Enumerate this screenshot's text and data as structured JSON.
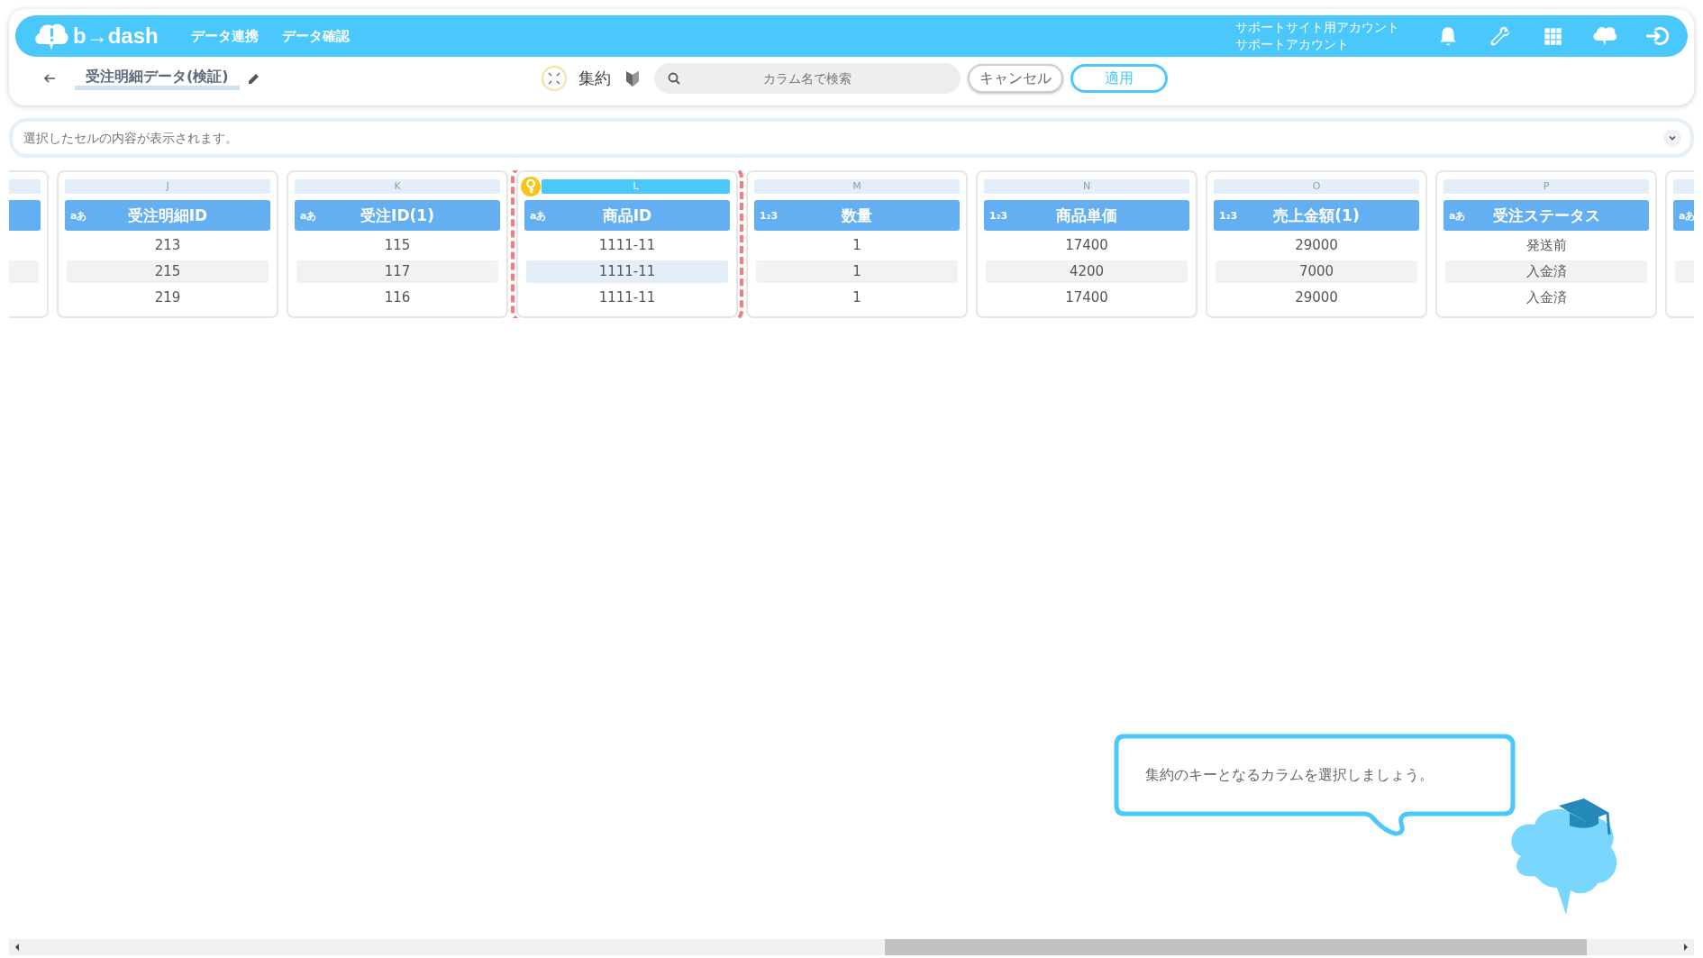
{
  "header": {
    "logo_text": "b→dash",
    "nav": [
      "データ連携",
      "データ確認"
    ],
    "account": [
      "サポートサイト用アカウント",
      "サポートアカウント"
    ]
  },
  "toolbar": {
    "title": "受注明細データ(検証)",
    "mode_label": "集約",
    "search": {
      "placeholder": "カラム名で検索"
    },
    "buttons": [
      {
        "label": "キャンセル",
        "kind": "secondary"
      },
      {
        "label": "適用",
        "kind": "primary"
      }
    ]
  },
  "cell_viewer": {
    "placeholder": "選択したセルの内容が表示されます。"
  },
  "columns": [
    {
      "kind": "clipped_left"
    },
    {
      "kind": "full",
      "letter": "J",
      "type_label": "aあ",
      "name": "受注明細ID",
      "key": false,
      "cells": [
        {
          "text": "213",
          "selected": false
        },
        {
          "text": "215",
          "selected": false
        },
        {
          "text": "219",
          "selected": false
        }
      ]
    },
    {
      "kind": "full",
      "letter": "K",
      "type_label": "aあ",
      "name": "受注ID(1)",
      "key": false,
      "cells": [
        {
          "text": "115",
          "selected": false
        },
        {
          "text": "117",
          "selected": false
        },
        {
          "text": "116",
          "selected": false
        }
      ]
    },
    {
      "kind": "full",
      "letter": "L",
      "type_label": "aあ",
      "name": "商品ID",
      "key": true,
      "cells": [
        {
          "text": "1111-11",
          "selected": false
        },
        {
          "text": "1111-11",
          "selected": true
        },
        {
          "text": "1111-11",
          "selected": false
        }
      ]
    },
    {
      "kind": "full",
      "letter": "M",
      "type_label": "1₂3",
      "name": "数量",
      "key": false,
      "cells": [
        {
          "text": "1",
          "selected": false
        },
        {
          "text": "1",
          "selected": false
        },
        {
          "text": "1",
          "selected": false
        }
      ]
    },
    {
      "kind": "full",
      "letter": "N",
      "type_label": "1₂3",
      "name": "商品単価",
      "key": false,
      "cells": [
        {
          "text": "17400",
          "selected": false
        },
        {
          "text": "4200",
          "selected": false
        },
        {
          "text": "17400",
          "selected": false
        }
      ]
    },
    {
      "kind": "full",
      "letter": "O",
      "type_label": "1₂3",
      "name": "売上金額(1)",
      "key": false,
      "cells": [
        {
          "text": "29000",
          "selected": false
        },
        {
          "text": "7000",
          "selected": false
        },
        {
          "text": "29000",
          "selected": false
        }
      ]
    },
    {
      "kind": "full",
      "letter": "P",
      "type_label": "aあ",
      "name": "受注ステータス",
      "key": false,
      "cells": [
        {
          "text": "発送前",
          "selected": false
        },
        {
          "text": "入金済",
          "selected": false
        },
        {
          "text": "入金済",
          "selected": false
        }
      ]
    },
    {
      "kind": "clipped_right",
      "type_label": "aあ"
    }
  ],
  "tooltip": {
    "text": "集約のキーとなるカラムを選択しましょう。"
  }
}
